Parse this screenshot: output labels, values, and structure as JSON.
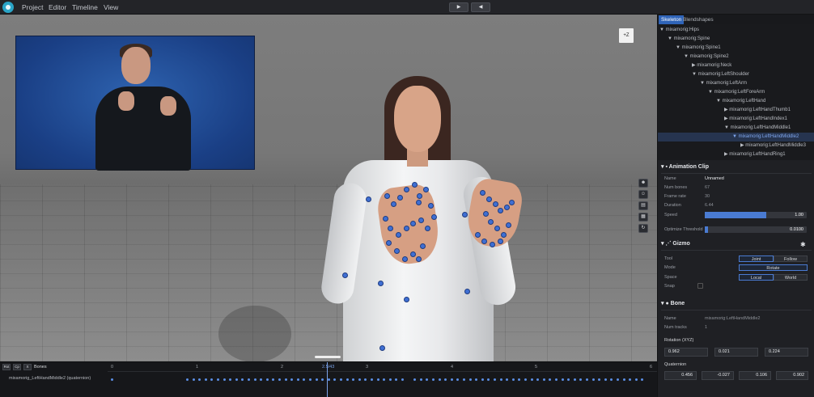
{
  "menubar": {
    "items": [
      "Project",
      "Editor",
      "Timeline",
      "View"
    ],
    "play_icon": "play-icon",
    "rewind_icon": "rewind-icon"
  },
  "viewport": {
    "axis_badge": "+Z"
  },
  "panel": {
    "tabs": [
      "Skeleton",
      "Blendshapes"
    ],
    "tree": [
      {
        "label": "▼ mixamorig:Hips"
      },
      {
        "label": "▼ mixamorig:Spine"
      },
      {
        "label": "▼ mixamorig:Spine1"
      },
      {
        "label": "▼ mixamorig:Spine2"
      },
      {
        "label": "▶ mixamorig:Neck"
      },
      {
        "label": "▼ mixamorig:LeftShoulder"
      },
      {
        "label": "▼ mixamorig:LeftArm"
      },
      {
        "label": "▼ mixamorig:LeftForeArm"
      },
      {
        "label": "▼ mixamorig:LeftHand"
      },
      {
        "label": "▶ mixamorig:LeftHandThumb1"
      },
      {
        "label": "▶ mixamorig:LeftHandIndex1"
      },
      {
        "label": "▼ mixamorig:LeftHandMiddle1"
      },
      {
        "label": "▼ mixamorig:LeftHandMiddle2"
      },
      {
        "label": "▶ mixamorig:LeftHandMiddle3"
      },
      {
        "label": "▶ mixamorig:LeftHandRing1"
      }
    ],
    "animation_clip": {
      "title": "Animation Clip",
      "name_label": "Name",
      "name_value": "Unnamed",
      "num_bones_label": "Num bones",
      "num_bones_value": "67",
      "frame_rate_label": "Frame rate",
      "frame_rate_value": "30",
      "duration_label": "Duration",
      "duration_value": "6.44",
      "speed_label": "Speed",
      "speed_value": "1.00",
      "speed_fraction": 0.6,
      "threshold_label": "Optimize Threshold",
      "threshold_value": "0.0100",
      "threshold_fraction": 0.03
    },
    "gizmo": {
      "title": "Gizmo",
      "tool_label": "Tool",
      "tool_options": [
        "Joint",
        "Follow"
      ],
      "mode_label": "Mode",
      "mode_value": "Rotate",
      "space_label": "Space",
      "space_options": [
        "Local",
        "World"
      ],
      "snap_label": "Snap"
    },
    "bone": {
      "title": "Bone",
      "name_label": "Name",
      "name_value": "mixamorig:LeftHandMiddle2",
      "num_tracks_label": "Num tracks",
      "num_tracks_value": "1",
      "rotation_label": "Rotation (XYZ)",
      "rotation": [
        "0.962",
        "0.021",
        "0.224"
      ],
      "quaternion_label": "Quaternion",
      "quaternion": [
        "0.456",
        "-0.027",
        "0.106",
        "0.902"
      ]
    }
  },
  "timeline": {
    "buttons": [
      "Rst",
      "Cp",
      "X"
    ],
    "bones_label": "Bones",
    "ticks": [
      "0",
      "1",
      "2",
      "2.5/43",
      "3",
      "4",
      "5",
      "6"
    ],
    "track_name": "mixamorig_LeftHandMiddle2 (quaternion)"
  },
  "colors": {
    "accent": "#2f64b8",
    "selected_bone": "#7fa6ec",
    "keyframe": "#5b8ee4",
    "panel_bg": "#1f2024"
  }
}
